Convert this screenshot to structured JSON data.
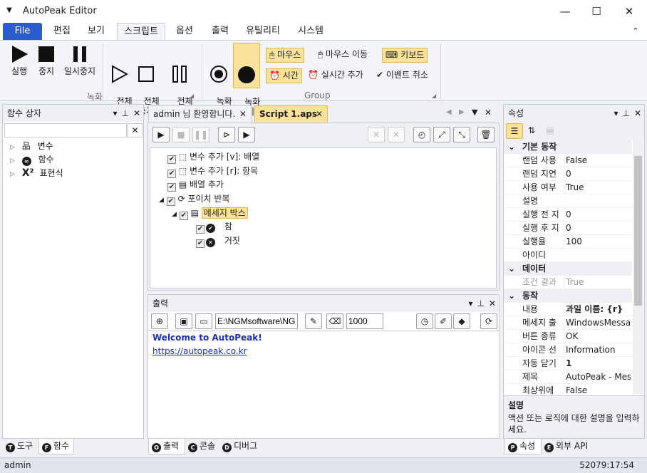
{
  "window": {
    "title": "AutoPeak Editor",
    "minimize": "—",
    "maximize": "☐",
    "close": "✕"
  },
  "menu": {
    "file": "File",
    "edit": "편집",
    "view": "보기",
    "script": "스크립트",
    "options": "옵션",
    "output": "출력",
    "utility": "유틸리티",
    "system": "시스템",
    "collapse": "⌃"
  },
  "ribbon": {
    "run": "실행",
    "stop": "중지",
    "pause": "일시중지",
    "run_all": "전체\n실행",
    "stop_all": "전체\n중지",
    "pause_all": "전체\n일시중지",
    "record_start": "녹화\n시작",
    "record_stop": "녹화\n중지",
    "group_record": "녹화",
    "mouse": "마우스",
    "mouse_move": "마우스 이동",
    "keyboard": "키보드",
    "time": "시간",
    "realtime_add": "실시간 추가",
    "event_cancel": "이벤트 취소",
    "group_group": "Group"
  },
  "function_box": {
    "title": "함수 상자",
    "search_placeholder": "",
    "items": [
      {
        "label": "변수",
        "icon": "hierarchy-icon"
      },
      {
        "label": "함수",
        "icon": "infinity-icon"
      },
      {
        "label": "표현식",
        "icon": "expression-icon"
      }
    ]
  },
  "doc_tabs": [
    {
      "label": "admin 님 환영합니다."
    },
    {
      "label": "Script 1.aps"
    }
  ],
  "script_tree": [
    {
      "label": "변수 추가 [v]: 배열"
    },
    {
      "label": "변수 추가 [r]: 항목"
    },
    {
      "label": "배열 추가"
    },
    {
      "label": "포이치 반복"
    },
    {
      "label": "메세지 박스"
    },
    {
      "label": "참"
    },
    {
      "label": "거짓"
    }
  ],
  "output": {
    "title": "출력",
    "path": "E:\\NGMsoftware\\NG",
    "limit": "1000",
    "line1": "Welcome to AutoPeak!",
    "line2": "https://autopeak.co.kr"
  },
  "bottom_tabs_left": [
    {
      "key": "T",
      "label": "도구"
    },
    {
      "key": "F",
      "label": "함수"
    }
  ],
  "bottom_tabs_mid": [
    {
      "key": "O",
      "label": "출력"
    },
    {
      "key": "C",
      "label": "콘솔"
    },
    {
      "key": "D",
      "label": "디버그"
    }
  ],
  "bottom_tabs_right": [
    {
      "key": "P",
      "label": "속성"
    },
    {
      "key": "E",
      "label": "외부 API"
    }
  ],
  "properties": {
    "title": "속성",
    "cat_basic": "기본 동작",
    "cat_data": "데이터",
    "cat_action": "동작",
    "rows_basic": [
      {
        "name": "랜덤 사용",
        "value": "False"
      },
      {
        "name": "랜덤 지연",
        "value": "0"
      },
      {
        "name": "사용 여부",
        "value": "True"
      },
      {
        "name": "설명",
        "value": ""
      },
      {
        "name": "실행 전 지",
        "value": "0"
      },
      {
        "name": "실행 후 지",
        "value": "0"
      },
      {
        "name": "실행율",
        "value": "100"
      },
      {
        "name": "아이디",
        "value": ""
      }
    ],
    "rows_data": [
      {
        "name": "조건 결과",
        "value": "True"
      }
    ],
    "rows_action": [
      {
        "name": "내용",
        "value": "과일 이름: {r}"
      },
      {
        "name": "메세지 출",
        "value": "WindowsMessage"
      },
      {
        "name": "버튼 종류",
        "value": "OK"
      },
      {
        "name": "아이콘 선",
        "value": "Information"
      },
      {
        "name": "자동 닫기",
        "value": "1"
      },
      {
        "name": "제목",
        "value": "AutoPeak - Message"
      },
      {
        "name": "최상위에",
        "value": "False"
      }
    ],
    "desc_title": "설명",
    "desc_text": "액션 또는 로직에 대한 설명을 입력하세요."
  },
  "status": {
    "user": "admin",
    "time": "52079:17:54"
  }
}
